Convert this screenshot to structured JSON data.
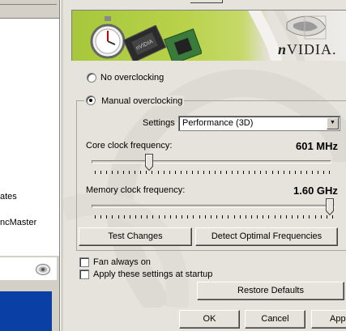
{
  "left_pane": {
    "tree_items": [
      "ates",
      "ncMaster"
    ]
  },
  "brand": {
    "logo_text_n": "n",
    "logo_text_rest": "VIDIA.",
    "accent": "#a7c73b"
  },
  "overclocking": {
    "no_overclocking_label": "No overclocking",
    "manual_overclocking_label": "Manual overclocking",
    "selected": "Manual overclocking",
    "settings_label": "Settings",
    "settings_value": "Performance (3D)",
    "core_clock_label": "Core clock frequency:",
    "core_clock_value": "601 MHz",
    "core_clock_level": 0.24,
    "memory_clock_label": "Memory clock frequency:",
    "memory_clock_value": "1.60 GHz",
    "memory_clock_level": 0.98,
    "test_changes_label": "Test Changes",
    "detect_optimal_label": "Detect Optimal Frequencies"
  },
  "options": {
    "fan_always_on_label": "Fan always on",
    "fan_always_on_checked": false,
    "apply_at_startup_label": "Apply these settings at startup",
    "apply_at_startup_checked": false,
    "restore_defaults_label": "Restore Defaults"
  },
  "dialog_buttons": {
    "ok_label": "OK",
    "cancel_label": "Cancel",
    "apply_label": "App"
  }
}
